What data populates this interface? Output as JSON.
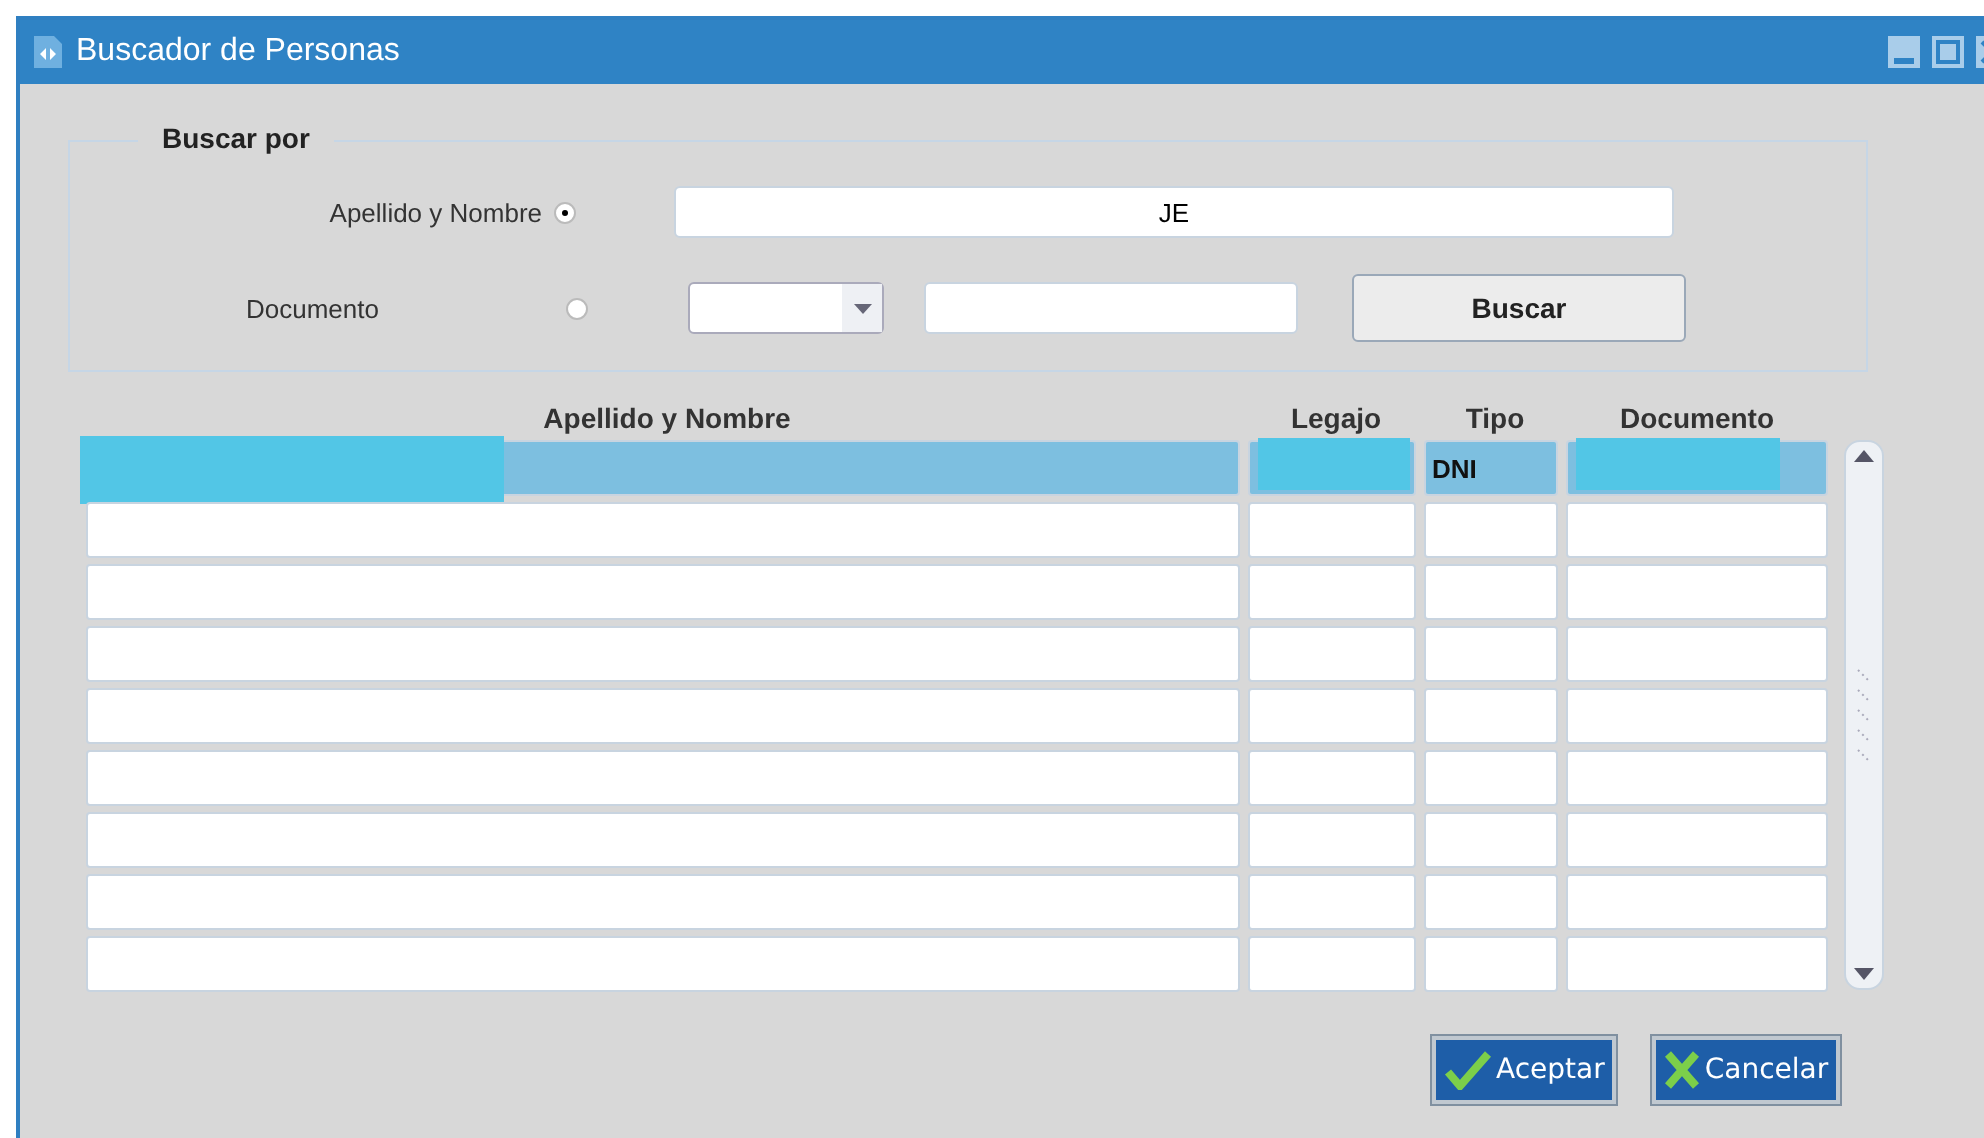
{
  "window": {
    "title": "Buscador de Personas"
  },
  "search": {
    "group_title": "Buscar por",
    "options": [
      {
        "label": "Apellido y Nombre",
        "selected": true
      },
      {
        "label": "Documento",
        "selected": false
      }
    ],
    "name_value": "JE",
    "button": "Buscar"
  },
  "table": {
    "columns": [
      "Apellido y Nombre",
      "Legajo",
      "Tipo",
      "Documento"
    ],
    "rows": [
      {
        "selected": true,
        "cells": [
          {
            "redacted": true
          },
          {
            "redacted": true
          },
          {
            "text": "DNI",
            "redacted": false
          },
          {
            "redacted": true
          }
        ]
      },
      {
        "selected": false,
        "cells": [
          {},
          {},
          {},
          {}
        ]
      },
      {
        "selected": false,
        "cells": [
          {},
          {},
          {},
          {}
        ]
      },
      {
        "selected": false,
        "cells": [
          {},
          {},
          {},
          {}
        ]
      },
      {
        "selected": false,
        "cells": [
          {},
          {},
          {},
          {}
        ]
      },
      {
        "selected": false,
        "cells": [
          {},
          {},
          {},
          {}
        ]
      },
      {
        "selected": false,
        "cells": [
          {},
          {},
          {},
          {}
        ]
      },
      {
        "selected": false,
        "cells": [
          {},
          {},
          {},
          {}
        ]
      },
      {
        "selected": false,
        "cells": [
          {},
          {},
          {},
          {}
        ]
      }
    ]
  },
  "buttons": [
    {
      "label": "Aceptar",
      "kind": "accept"
    },
    {
      "label": "Cancelar",
      "kind": "cancel"
    }
  ]
}
